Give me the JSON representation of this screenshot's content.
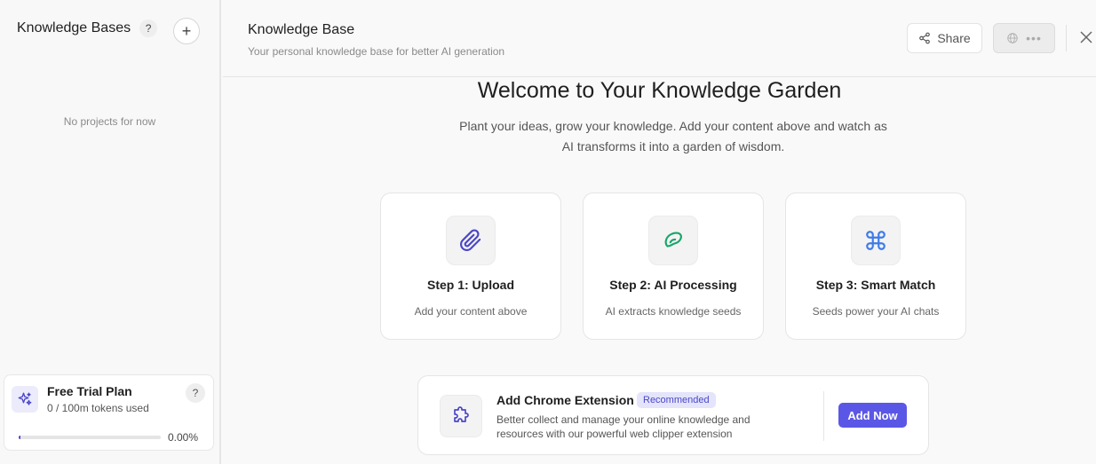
{
  "sidebar": {
    "title": "Knowledge Bases",
    "help": "?",
    "add": "+",
    "empty_text": "No projects for now",
    "plan": {
      "title": "Free Trial Plan",
      "usage": "0 / 100m tokens used",
      "help": "?",
      "progress_fraction": 0.0,
      "percent_label": "0.00%"
    }
  },
  "header": {
    "title": "Knowledge Base",
    "subtitle": "Your personal knowledge base for better AI generation",
    "share_label": "Share",
    "more_label": "•••"
  },
  "main": {
    "welcome": "Welcome to Your Knowledge Garden",
    "desc_line1": "Plant your ideas, grow your knowledge. Add your content above and watch as",
    "desc_line2": "AI transforms it into a garden of wisdom.",
    "steps": [
      {
        "title": "Step 1: Upload",
        "desc": "Add your content above",
        "icon": "paperclip-icon",
        "color": "#4b47c8"
      },
      {
        "title": "Step 2: AI Processing",
        "desc": "AI extracts knowledge seeds",
        "icon": "seed-icon",
        "color": "#17a56a"
      },
      {
        "title": "Step 3: Smart Match",
        "desc": "Seeds power your AI chats",
        "icon": "command-icon",
        "color": "#3f7be8"
      }
    ],
    "extension": {
      "title": "Add Chrome Extension",
      "badge": "Recommended",
      "desc": "Better collect and manage your online knowledge and resources with our powerful web clipper extension",
      "button": "Add Now",
      "icon": "puzzle-icon"
    }
  },
  "colors": {
    "accent": "#5b57e6",
    "badge_bg": "#e4e4fb"
  }
}
